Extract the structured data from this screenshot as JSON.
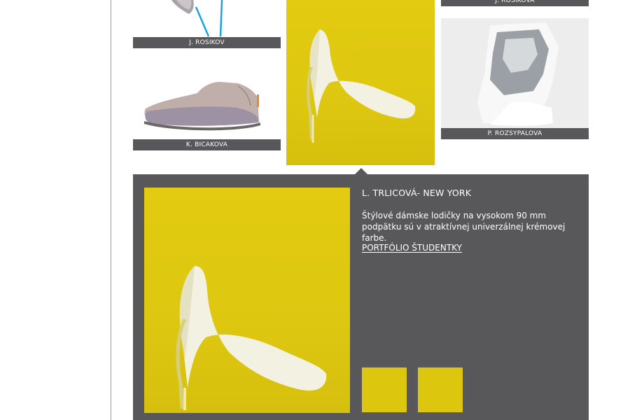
{
  "gallery": {
    "items": [
      {
        "caption": "J. ROSIKOV"
      },
      {
        "caption": "K. BICAKOVA"
      },
      {
        "caption": "J. ROSIKOVA"
      },
      {
        "caption": "P. ROZSYPALOVA"
      }
    ]
  },
  "detail": {
    "title": "L. TRLICOVÁ- NEW YORK",
    "description": "Štýlové dámske lodičky na  vysokom 90 mm podpätku sú v atraktívnej univerzálnej krémovej farbe.",
    "portfolio_link": "PORTFÓLIO ŠTUDENTKY"
  },
  "colors": {
    "accent_yellow": "#dcc60e",
    "panel_gray": "#58585a"
  }
}
